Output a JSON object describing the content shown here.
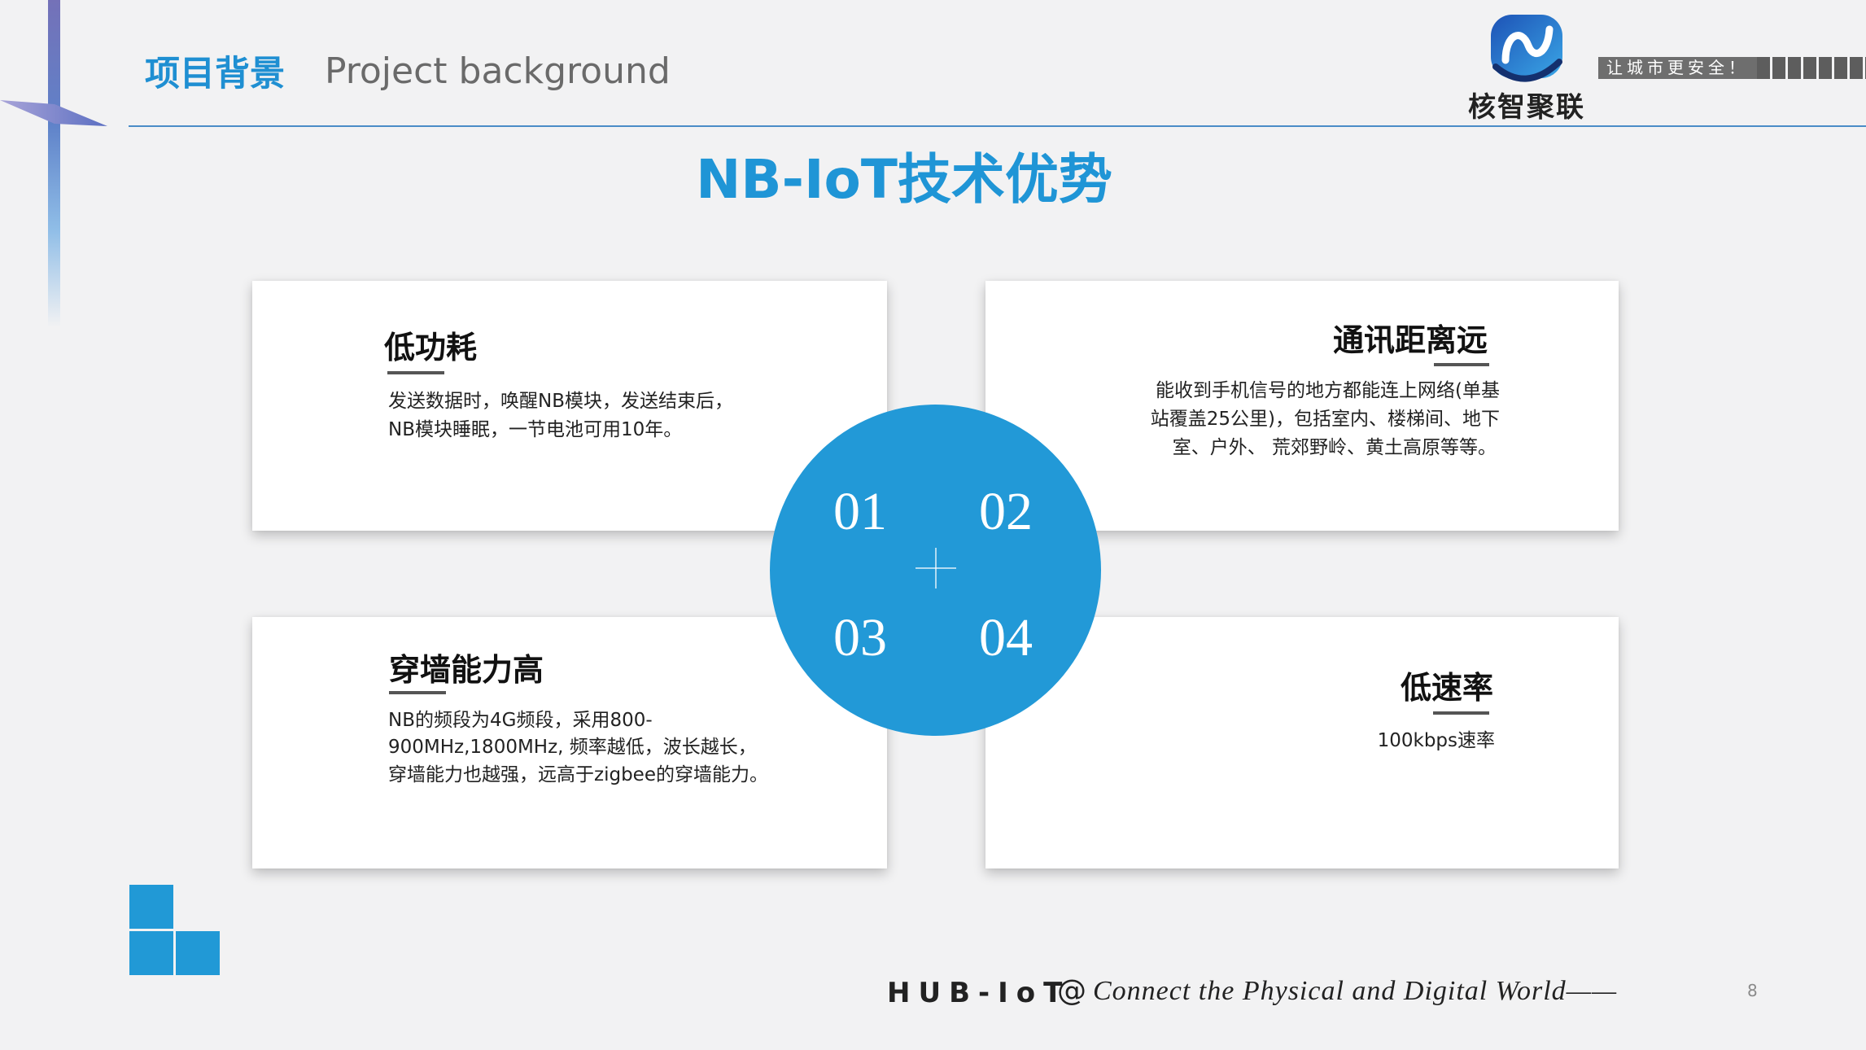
{
  "header": {
    "title_cn": "项目背景",
    "title_en": "Project background"
  },
  "brand": {
    "logo_icon": "hezhi-julian-logo",
    "name": "核智聚联",
    "slogan": "让城市更安全！"
  },
  "main": {
    "title": "NB-IoT技术优势"
  },
  "cards": [
    {
      "heading": "低功耗",
      "lines": [
        "发送数据时，唤醒NB模块，发送结束后，",
        "NB模块睡眠，一节电池可用10年。"
      ]
    },
    {
      "heading": "通讯距离远",
      "lines": [
        "能收到手机信号的地方都能连上网络(单基",
        "站覆盖25公里)，包括室内、楼梯间、地下",
        "室、户外、 荒郊野岭、黄土高原等等。"
      ]
    },
    {
      "heading": "穿墙能力高",
      "lines": [
        "NB的频段为4G频段，采用800-",
        "900MHz,1800MHz, 频率越低，波长越长，",
        "穿墙能力也越强，远高于zigbee的穿墙能力。"
      ]
    },
    {
      "heading": "低速率",
      "lines": [
        "100kbps速率"
      ]
    }
  ],
  "center_circle": {
    "numbers": [
      "01",
      "02",
      "03",
      "04"
    ],
    "center_icon": "plus-icon"
  },
  "footer": {
    "brand": "HUB-IoT",
    "at": "@",
    "tagline": "Connect the Physical and Digital World——",
    "page_number": "8"
  },
  "colors": {
    "accent": "#1f95d6",
    "circle": "#2299d7",
    "background": "#f2f2f3",
    "heading_text": "#111111",
    "divider": "#4a8cc7"
  }
}
